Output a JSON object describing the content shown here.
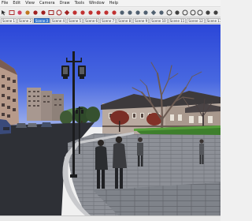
{
  "menubar": {
    "items": [
      "File",
      "Edit",
      "View",
      "Camera",
      "Draw",
      "Tools",
      "Window",
      "Help"
    ]
  },
  "toolbar": {
    "tools": [
      {
        "name": "select-tool-icon",
        "color": "#333333"
      },
      {
        "name": "make-component-icon",
        "color": "#b03030"
      },
      {
        "name": "eraser-icon",
        "color": "#d04060"
      },
      {
        "name": "paint-bucket-icon",
        "color": "#c07820"
      },
      {
        "name": "line-tool-icon",
        "color": "#a02020"
      },
      {
        "name": "arc-tool-icon",
        "color": "#a02020"
      },
      {
        "name": "rectangle-tool-icon",
        "color": "#a02020"
      },
      {
        "name": "circle-tool-icon",
        "color": "#a02020"
      },
      {
        "name": "polygon-tool-icon",
        "color": "#a02020"
      },
      {
        "name": "move-tool-icon",
        "color": "#c03030"
      },
      {
        "name": "push-pull-tool-icon",
        "color": "#c03030"
      },
      {
        "name": "rotate-tool-icon",
        "color": "#c03030"
      },
      {
        "name": "follow-me-tool-icon",
        "color": "#c03030"
      },
      {
        "name": "scale-tool-icon",
        "color": "#c03030"
      },
      {
        "name": "offset-tool-icon",
        "color": "#c03030"
      },
      {
        "name": "tape-measure-icon",
        "color": "#506070"
      },
      {
        "name": "dimension-icon",
        "color": "#506070"
      },
      {
        "name": "protractor-icon",
        "color": "#506070"
      },
      {
        "name": "text-tool-icon",
        "color": "#506070"
      },
      {
        "name": "axes-tool-icon",
        "color": "#506070"
      },
      {
        "name": "3d-text-icon",
        "color": "#506070"
      },
      {
        "name": "orbit-tool-icon",
        "color": "#404040"
      },
      {
        "name": "pan-tool-icon",
        "color": "#404040"
      },
      {
        "name": "zoom-tool-icon",
        "color": "#404040"
      },
      {
        "name": "zoom-window-icon",
        "color": "#404040"
      },
      {
        "name": "zoom-extents-icon",
        "color": "#404040"
      },
      {
        "name": "previous-view-icon",
        "color": "#404040"
      },
      {
        "name": "get-models-icon",
        "color": "#404040"
      }
    ]
  },
  "scene_tabs": [
    {
      "label": "Scene 1",
      "active": false
    },
    {
      "label": "Scene 2",
      "active": false
    },
    {
      "label": "Scene 3",
      "active": true
    },
    {
      "label": "Scene 4",
      "active": false
    },
    {
      "label": "Scene 5",
      "active": false
    },
    {
      "label": "Scene 6",
      "active": false
    },
    {
      "label": "Scene 7",
      "active": false
    },
    {
      "label": "Scene 8",
      "active": false
    },
    {
      "label": "Scene 9",
      "active": false
    },
    {
      "label": "Scene 10",
      "active": false
    },
    {
      "label": "Scene 11",
      "active": false
    },
    {
      "label": "Scene 12",
      "active": false
    },
    {
      "label": "Scene 13",
      "active": false
    },
    {
      "label": "Scene 14",
      "active": false
    }
  ],
  "colors": {
    "sky": "#2b46d8",
    "sky_horizon": "#9eb0ec",
    "road": "#2e3036",
    "plaza": "#8d9097",
    "curb": "#c8c9cc",
    "lamp": "#1b1c1e",
    "grass": "#3e7f2c",
    "building": "#b9aaa0",
    "roof": "#3d3a3c"
  },
  "statusbar": {
    "text": ""
  }
}
